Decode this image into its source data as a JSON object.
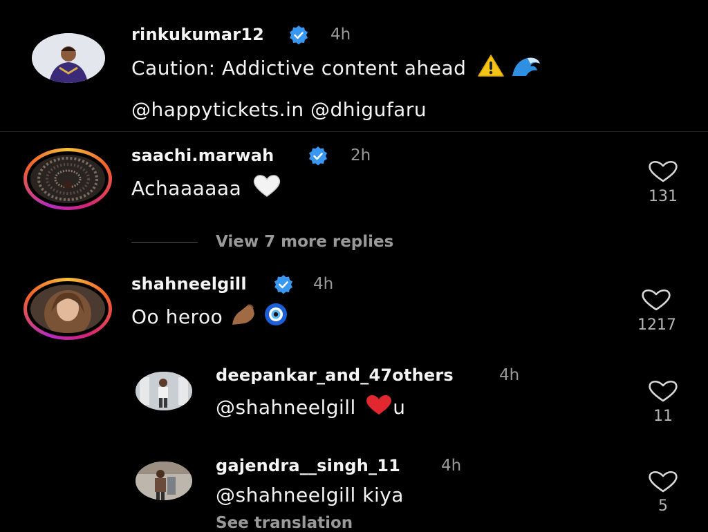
{
  "post": {
    "username": "rinkukumar12",
    "time": "4h",
    "caption": "Caution: Addictive content ahead",
    "caption_emojis": [
      "warning-emoji",
      "wave-emoji"
    ],
    "mentions": "@happytickets.in @dhigufaru"
  },
  "comments": [
    {
      "username": "saachi.marwah",
      "time": "2h",
      "text": "Achaaaaaa",
      "emoji": "white-heart-emoji",
      "likes": "131"
    },
    {
      "username": "shahneelgill",
      "time": "4h",
      "text": "Oo heroo",
      "emoji": "pinched-fingers-emoji, evil-eye-emoji",
      "likes": "1217"
    }
  ],
  "view_replies": "View 7 more replies",
  "replies": [
    {
      "username": "deepankar_and_47others",
      "time": "4h",
      "text_mention": "@shahneelgill",
      "text_suffix": "u",
      "emoji": "red-heart-emoji",
      "likes": "11"
    },
    {
      "username": "gajendra__singh_11",
      "time": "4h",
      "text": "@shahneelgill kiya",
      "likes": "5",
      "see_translation": "See translation"
    }
  ],
  "colors": {
    "background": "#000000",
    "verified": "#3897f0",
    "secondary_text": "#9a9a9a",
    "heart_red": "#e0282e"
  }
}
